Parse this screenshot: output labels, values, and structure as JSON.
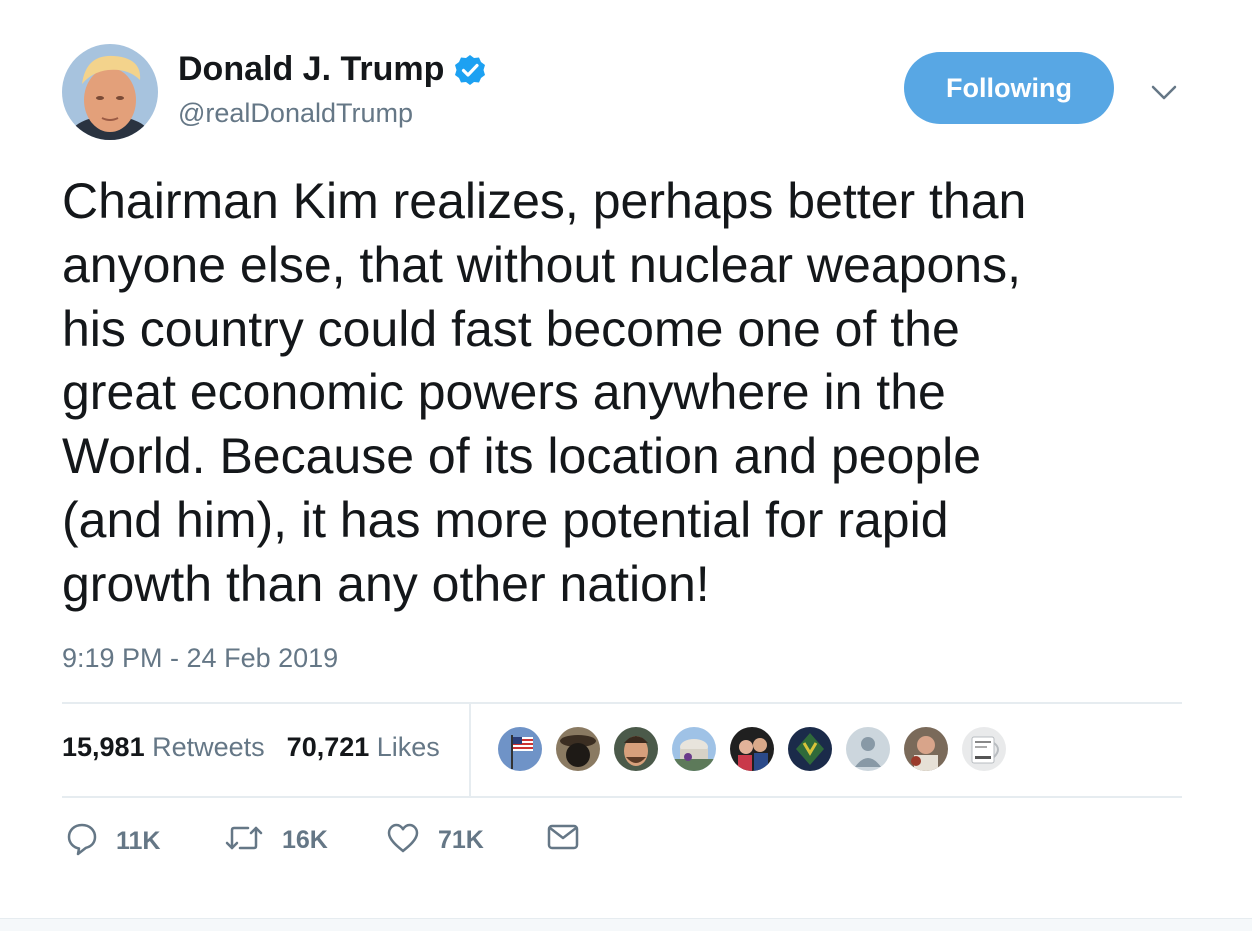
{
  "tweet": {
    "author": {
      "display_name": "Donald J. Trump",
      "handle": "@realDonaldTrump",
      "verified": true
    },
    "follow_button_label": "Following",
    "text_lines": [
      "Chairman Kim realizes, perhaps better than",
      "anyone else, that without nuclear weapons,",
      "his country could fast become one of the",
      "great economic powers anywhere in the",
      "World. Because of its location and people",
      "(and him), it has more potential for rapid",
      "growth than any other nation!"
    ],
    "timestamp": "9:19 PM - 24 Feb 2019",
    "stats": {
      "retweets_count": "15,981",
      "retweets_label": "Retweets",
      "likes_count": "70,721",
      "likes_label": "Likes"
    },
    "actions": {
      "reply_count": "11K",
      "retweet_count": "16K",
      "like_count": "71K"
    },
    "icons": [
      "verified-badge-icon",
      "chevron-down-icon",
      "reply-icon",
      "retweet-icon",
      "like-icon",
      "direct-message-icon"
    ]
  },
  "colors": {
    "accent": "#58a7e4",
    "verified": "#1da1f2",
    "secondary_text": "#657786",
    "divider": "#e6ecf0",
    "text": "#14171a"
  }
}
